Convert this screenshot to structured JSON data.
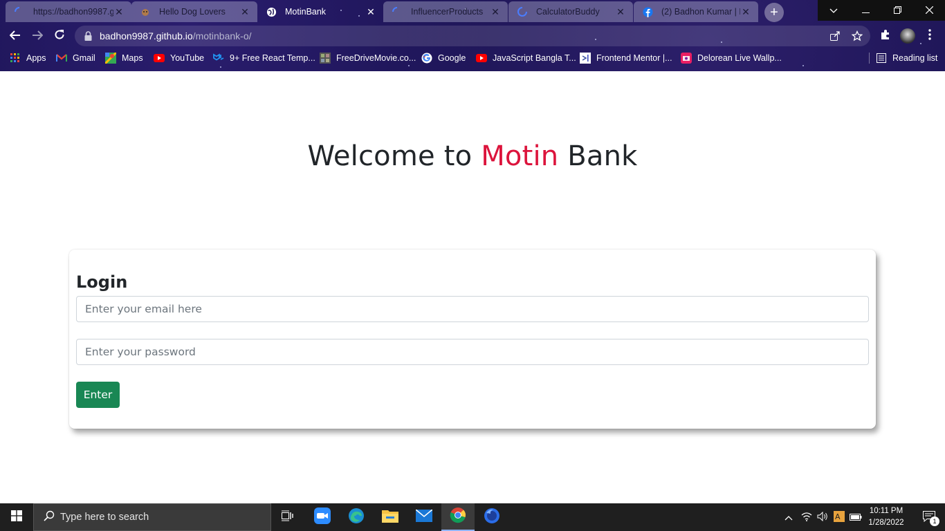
{
  "browser": {
    "tabs": [
      {
        "title": "https://badhon9987.g",
        "icon": "loading-icon",
        "active": false
      },
      {
        "title": "Hello Dog Lovers",
        "icon": "dog-icon",
        "active": false
      },
      {
        "title": "MotinBank",
        "icon": "globe-icon",
        "active": true
      },
      {
        "title": "InfluencerProducts",
        "icon": "loading-icon",
        "active": false
      },
      {
        "title": "CalculatorBuddy",
        "icon": "loading-icon",
        "active": false
      },
      {
        "title": "(2) Badhon Kumar | Fa",
        "icon": "facebook-icon",
        "active": false
      }
    ],
    "address": {
      "host": "badhon9987.github.io",
      "path": "/motinbank-o/"
    },
    "bookmarks": [
      {
        "label": "Apps",
        "icon": "apps-grid-icon"
      },
      {
        "label": "Gmail",
        "icon": "gmail-icon"
      },
      {
        "label": "Maps",
        "icon": "maps-icon"
      },
      {
        "label": "YouTube",
        "icon": "youtube-icon"
      },
      {
        "label": "9+ Free React Temp...",
        "icon": "mui-icon"
      },
      {
        "label": "FreeDriveMovie.co...",
        "icon": "movie-icon"
      },
      {
        "label": "Google",
        "icon": "google-icon"
      },
      {
        "label": "JavaScript Bangla T...",
        "icon": "youtube-icon"
      },
      {
        "label": "Frontend Mentor |...",
        "icon": "frontend-mentor-icon"
      },
      {
        "label": "Delorean Live Wallp...",
        "icon": "wallpaper-icon"
      }
    ],
    "reading_list": "Reading list"
  },
  "page": {
    "welcome_prefix": "Welcome to ",
    "welcome_accent": "Motin",
    "welcome_suffix": " Bank",
    "login_title": "Login",
    "email_placeholder": "Enter your email here",
    "password_placeholder": "Enter your password",
    "enter_label": "Enter",
    "accent_color": "#dc143c",
    "button_color": "#198754"
  },
  "taskbar": {
    "search_placeholder": "Type here to search",
    "time": "10:11 PM",
    "date": "1/28/2022",
    "notification_count": "1"
  }
}
